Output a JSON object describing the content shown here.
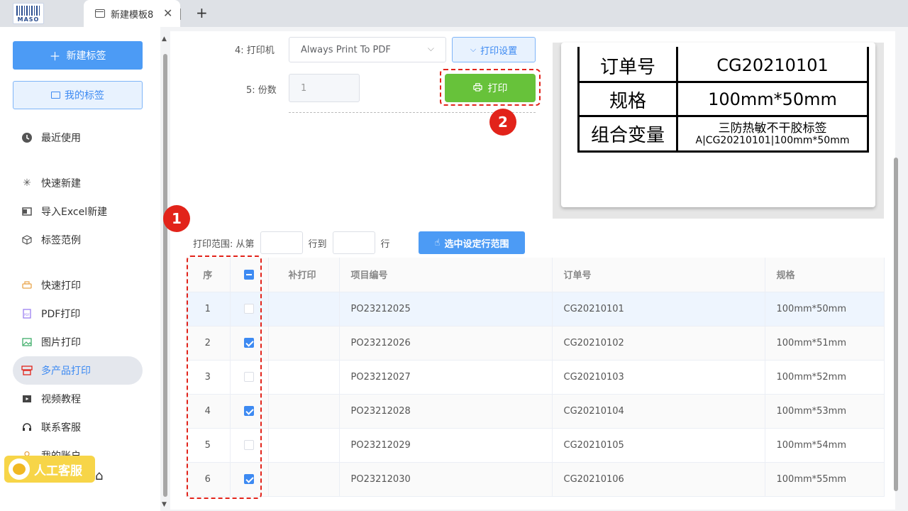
{
  "tabbar": {
    "logo_text": "MASO",
    "tab_title": "新建模板8",
    "close_glyph": "✕",
    "new_tab_glyph": "+"
  },
  "sidebar": {
    "new_label_button": "新建标签",
    "my_labels_button": "我的标签",
    "items": [
      {
        "label": "最近使用",
        "icon": "clock-icon"
      },
      {
        "label": "快速新建",
        "icon": "sparkle-icon"
      },
      {
        "label": "导入Excel新建",
        "icon": "excel-icon"
      },
      {
        "label": "标签范例",
        "icon": "cube-icon"
      },
      {
        "label": "快速打印",
        "icon": "printer-icon"
      },
      {
        "label": "PDF打印",
        "icon": "pdf-icon"
      },
      {
        "label": "图片打印",
        "icon": "image-icon"
      },
      {
        "label": "多产品打印",
        "icon": "multi-print-icon",
        "active": true
      },
      {
        "label": "视频教程",
        "icon": "video-icon"
      },
      {
        "label": "联系客服",
        "icon": "headset-icon"
      },
      {
        "label": "我的账户",
        "icon": "user-icon"
      }
    ],
    "help_badge": "人工客服"
  },
  "form": {
    "printer_label": "4: 打印机",
    "printer_value": "Always Print To PDF",
    "printer_settings_button": "打印设置",
    "copies_label": "5: 份数",
    "copies_value": "1",
    "print_button": "打印"
  },
  "annotations": {
    "marker1": "1",
    "marker2": "2"
  },
  "label_preview": {
    "rows": [
      {
        "key": "订单号",
        "value": "CG20210101"
      },
      {
        "key": "规格",
        "value": "100mm*50mm"
      },
      {
        "key": "组合变量",
        "value_line1": "三防热敏不干胶标签",
        "value_line2": "A|CG20210101|100mm*50mm"
      }
    ]
  },
  "range": {
    "prefix": "打印范围: 从第",
    "middle": "行到",
    "suffix": "行",
    "from_value": "",
    "to_value": "",
    "apply_button": "选中设定行范围"
  },
  "table": {
    "headers": [
      "序",
      "",
      "补打印",
      "项目编号",
      "订单号",
      "规格"
    ],
    "rows": [
      {
        "seq": "1",
        "checked": false,
        "reprint": "",
        "item_no": "PO23212025",
        "order_no": "CG20210101",
        "spec": "100mm*50mm"
      },
      {
        "seq": "2",
        "checked": true,
        "reprint": "",
        "item_no": "PO23212026",
        "order_no": "CG20210102",
        "spec": "100mm*51mm"
      },
      {
        "seq": "3",
        "checked": false,
        "reprint": "",
        "item_no": "PO23212027",
        "order_no": "CG20210103",
        "spec": "100mm*52mm"
      },
      {
        "seq": "4",
        "checked": true,
        "reprint": "",
        "item_no": "PO23212028",
        "order_no": "CG20210104",
        "spec": "100mm*53mm"
      },
      {
        "seq": "5",
        "checked": false,
        "reprint": "",
        "item_no": "PO23212029",
        "order_no": "CG20210105",
        "spec": "100mm*54mm"
      },
      {
        "seq": "6",
        "checked": true,
        "reprint": "",
        "item_no": "PO23212030",
        "order_no": "CG20210106",
        "spec": "100mm*55mm"
      }
    ]
  },
  "colors": {
    "accent": "#4c9bf5",
    "print_green": "#67c23a",
    "annotation_red": "#e2231a",
    "help_yellow": "#f7d548"
  }
}
